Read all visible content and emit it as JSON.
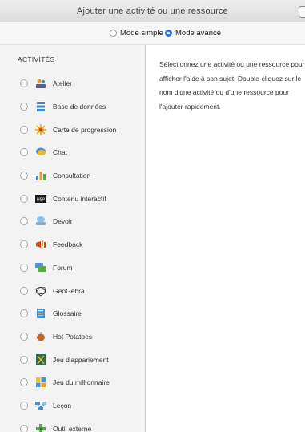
{
  "window": {
    "title": "Ajouter une activité ou une ressource"
  },
  "modes": [
    {
      "label": "Mode simple",
      "checked": false
    },
    {
      "label": "Mode avancé",
      "checked": true
    }
  ],
  "sidebar": {
    "heading": "ACTIVITÉS",
    "items": [
      {
        "label": "Atelier",
        "icon": "workshop-icon"
      },
      {
        "label": "Base de données",
        "icon": "database-icon"
      },
      {
        "label": "Carte de progression",
        "icon": "progress-map-icon"
      },
      {
        "label": "Chat",
        "icon": "chat-icon"
      },
      {
        "label": "Consultation",
        "icon": "poll-icon"
      },
      {
        "label": "Contenu interactif",
        "icon": "h5p-icon"
      },
      {
        "label": "Devoir",
        "icon": "assignment-icon"
      },
      {
        "label": "Feedback",
        "icon": "feedback-icon"
      },
      {
        "label": "Forum",
        "icon": "forum-icon"
      },
      {
        "label": "GeoGebra",
        "icon": "geogebra-icon"
      },
      {
        "label": "Glossaire",
        "icon": "glossary-icon"
      },
      {
        "label": "Hot Potatoes",
        "icon": "hot-potatoes-icon"
      },
      {
        "label": "Jeu d'appariement",
        "icon": "matching-game-icon"
      },
      {
        "label": "Jeu du millionnaire",
        "icon": "millionaire-game-icon"
      },
      {
        "label": "Leçon",
        "icon": "lesson-icon"
      },
      {
        "label": "Outil externe",
        "icon": "external-tool-icon"
      }
    ]
  },
  "help": {
    "text": "Sélectionnez une activité ou une ressource pour afficher l'aide à son sujet. Double-cliquez sur le nom d'une activité ou d'une ressource pour l'ajouter rapidement."
  }
}
